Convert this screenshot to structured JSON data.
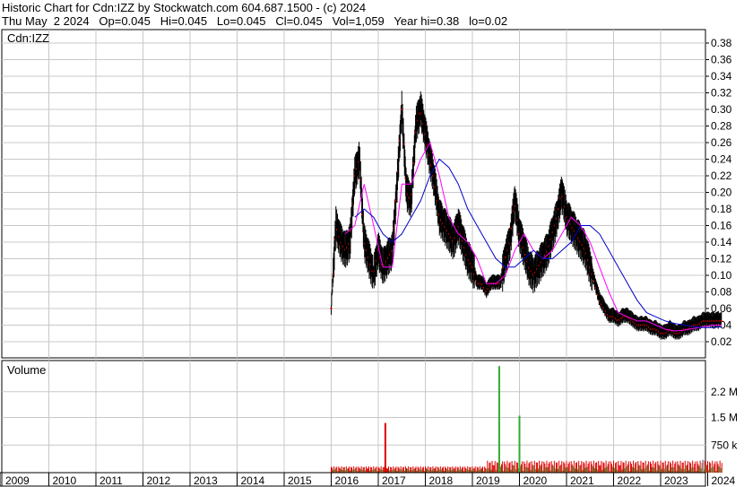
{
  "header": {
    "line1": "Historic Chart for Cdn:IZZ by Stockwatch.com 604.687.1500 - (c) 2024",
    "line2": "Thu May  2 2024   Op=0.045   Hi=0.045   Lo=0.045   Cl=0.045   Vol=1,059   Year hi=0.38   lo=0.02"
  },
  "chart_data": [
    {
      "type": "line",
      "panel_label": "Cdn:IZZ",
      "ylim": [
        0,
        0.39
      ],
      "yticks": [
        "0.38",
        "0.36",
        "0.34",
        "0.32",
        "0.30",
        "0.28",
        "0.26",
        "0.24",
        "0.22",
        "0.20",
        "0.18",
        "0.16",
        "0.14",
        "0.12",
        "0.10",
        "0.08",
        "0.06",
        "0.04",
        "0.02"
      ],
      "grid": true,
      "series": [
        {
          "style": "price",
          "color": "#000000",
          "x": [
            2016.0,
            2016.1,
            2016.2,
            2016.3,
            2016.4,
            2016.5,
            2016.6,
            2016.7,
            2016.8,
            2016.9,
            2017.0,
            2017.1,
            2017.2,
            2017.3,
            2017.4,
            2017.5,
            2017.6,
            2017.7,
            2017.8,
            2017.9,
            2018.0,
            2018.1,
            2018.2,
            2018.3,
            2018.4,
            2018.5,
            2018.6,
            2018.7,
            2018.8,
            2018.9,
            2019.0,
            2019.1,
            2019.2,
            2019.3,
            2019.4,
            2019.5,
            2019.6,
            2019.7,
            2019.8,
            2019.9,
            2020.0,
            2020.1,
            2020.2,
            2020.3,
            2020.4,
            2020.5,
            2020.6,
            2020.7,
            2020.8,
            2020.9,
            2021.0,
            2021.1,
            2021.2,
            2021.3,
            2021.4,
            2021.5,
            2021.6,
            2021.7,
            2021.8,
            2021.9,
            2022.0,
            2022.1,
            2022.2,
            2022.3,
            2022.4,
            2022.5,
            2022.6,
            2022.7,
            2022.8,
            2022.9,
            2023.0,
            2023.1,
            2023.2,
            2023.3,
            2023.4,
            2023.5,
            2023.6,
            2023.7,
            2023.8,
            2023.9,
            2024.0,
            2024.1,
            2024.2,
            2024.3
          ],
          "y": [
            0.06,
            0.16,
            0.14,
            0.13,
            0.14,
            0.22,
            0.24,
            0.14,
            0.12,
            0.1,
            0.13,
            0.11,
            0.12,
            0.13,
            0.21,
            0.3,
            0.2,
            0.19,
            0.28,
            0.3,
            0.27,
            0.24,
            0.21,
            0.17,
            0.16,
            0.15,
            0.14,
            0.16,
            0.14,
            0.12,
            0.11,
            0.09,
            0.09,
            0.08,
            0.09,
            0.09,
            0.09,
            0.12,
            0.14,
            0.19,
            0.15,
            0.13,
            0.11,
            0.1,
            0.11,
            0.12,
            0.13,
            0.15,
            0.17,
            0.2,
            0.17,
            0.16,
            0.15,
            0.14,
            0.13,
            0.11,
            0.09,
            0.07,
            0.06,
            0.05,
            0.05,
            0.045,
            0.05,
            0.05,
            0.045,
            0.04,
            0.04,
            0.04,
            0.035,
            0.035,
            0.03,
            0.03,
            0.035,
            0.03,
            0.03,
            0.035,
            0.035,
            0.04,
            0.04,
            0.045,
            0.045,
            0.045,
            0.045,
            0.045
          ]
        },
        {
          "style": "moving-average-short",
          "color": "#ff00ff",
          "x": [
            2016.3,
            2016.5,
            2016.7,
            2016.9,
            2017.1,
            2017.3,
            2017.5,
            2017.7,
            2017.9,
            2018.1,
            2018.3,
            2018.5,
            2018.7,
            2018.9,
            2019.1,
            2019.3,
            2019.5,
            2019.7,
            2019.9,
            2020.1,
            2020.3,
            2020.5,
            2020.7,
            2020.9,
            2021.1,
            2021.3,
            2021.5,
            2021.7,
            2021.9,
            2022.1,
            2022.3,
            2022.5,
            2022.7,
            2022.9,
            2023.1,
            2023.3,
            2023.5,
            2023.7,
            2023.9,
            2024.1,
            2024.3
          ],
          "y": [
            0.15,
            0.16,
            0.21,
            0.16,
            0.11,
            0.11,
            0.21,
            0.21,
            0.24,
            0.26,
            0.22,
            0.17,
            0.15,
            0.14,
            0.12,
            0.09,
            0.09,
            0.1,
            0.13,
            0.15,
            0.13,
            0.12,
            0.13,
            0.15,
            0.17,
            0.16,
            0.14,
            0.11,
            0.08,
            0.055,
            0.05,
            0.045,
            0.045,
            0.04,
            0.035,
            0.033,
            0.034,
            0.036,
            0.038,
            0.04,
            0.04
          ]
        },
        {
          "style": "moving-average-long",
          "color": "#0000cc",
          "x": [
            2016.5,
            2016.7,
            2016.9,
            2017.1,
            2017.3,
            2017.5,
            2017.7,
            2017.9,
            2018.1,
            2018.3,
            2018.5,
            2018.7,
            2018.9,
            2019.1,
            2019.3,
            2019.5,
            2019.7,
            2019.9,
            2020.1,
            2020.3,
            2020.5,
            2020.7,
            2020.9,
            2021.1,
            2021.3,
            2021.5,
            2021.7,
            2021.9,
            2022.1,
            2022.3,
            2022.5,
            2022.7,
            2022.9,
            2023.1,
            2023.3,
            2023.5,
            2023.7,
            2023.9,
            2024.1,
            2024.3
          ],
          "y": [
            0.17,
            0.18,
            0.17,
            0.15,
            0.14,
            0.15,
            0.17,
            0.19,
            0.22,
            0.24,
            0.23,
            0.21,
            0.18,
            0.16,
            0.14,
            0.12,
            0.11,
            0.11,
            0.12,
            0.13,
            0.12,
            0.12,
            0.13,
            0.14,
            0.16,
            0.16,
            0.15,
            0.13,
            0.11,
            0.09,
            0.07,
            0.055,
            0.05,
            0.045,
            0.042,
            0.04,
            0.038,
            0.037,
            0.037,
            0.038
          ]
        }
      ]
    },
    {
      "type": "bar",
      "panel_label": "Volume",
      "ylim": [
        0,
        3000000
      ],
      "yticks": [
        "2.2 M",
        "1.5 M",
        "750 k"
      ],
      "ytick_values": [
        2200000,
        1500000,
        750000
      ],
      "spikes": [
        {
          "x": 2017.15,
          "value": 1350000,
          "color": "#dd0000"
        },
        {
          "x": 2019.57,
          "value": 2900000,
          "color": "#33aa33"
        },
        {
          "x": 2020.0,
          "value": 1550000,
          "color": "#33aa33"
        },
        {
          "x": 2023.9,
          "value": 350000,
          "color": "#999999"
        }
      ],
      "colors": {
        "up": "#33aa33",
        "down": "#dd0000",
        "flat": "#999999"
      }
    }
  ],
  "x_axis": {
    "labels": [
      "2009",
      "2010",
      "2011",
      "2012",
      "2013",
      "2014",
      "2015",
      "2016",
      "2017",
      "2018",
      "2019",
      "2020",
      "2021",
      "2022",
      "2023",
      "2024"
    ]
  }
}
